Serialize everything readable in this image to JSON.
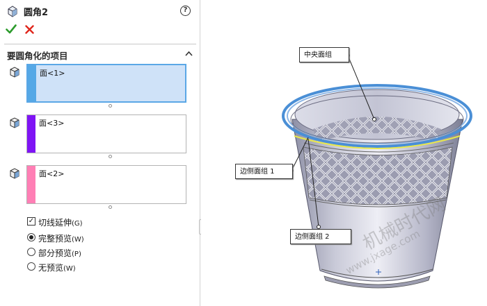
{
  "panel": {
    "title": "圆角2",
    "help_icon": "?",
    "section_title": "要圆角化的项目",
    "selections": [
      {
        "label": "面<1>",
        "color": "#55a8e6"
      },
      {
        "label": "面<3>",
        "color": "#7f14f5"
      },
      {
        "label": "面<2>",
        "color": "#ff7fb5"
      }
    ],
    "tangent_propagation": {
      "label": "切线延伸",
      "key": "(G)",
      "checked": true
    },
    "preview_options": [
      {
        "label": "完整预览",
        "key": "(W)",
        "selected": true
      },
      {
        "label": "部分预览",
        "key": "(P)",
        "selected": false
      },
      {
        "label": "无预览",
        "key": "(W)",
        "selected": false
      }
    ]
  },
  "viewport": {
    "callouts": {
      "center": "中央面组",
      "side1": "边侧面组  1",
      "side2": "边侧面组  2"
    },
    "watermark": {
      "line1": "机械时代网",
      "line2": "www.jxage.com"
    }
  },
  "colors": {
    "ok": "#2c9b2c",
    "cancel": "#e0261c",
    "rim_highlight": "#4a8fd6",
    "edge_highlight": "#e8e84a"
  }
}
